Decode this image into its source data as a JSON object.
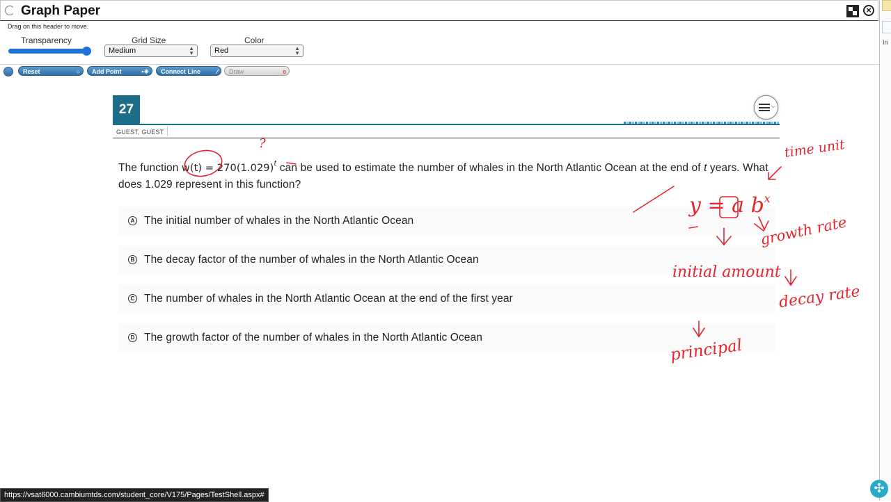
{
  "graph_paper": {
    "title": "Graph Paper",
    "drag_hint": "Drag on this header to move.",
    "transparency_label": "Transparency",
    "transparency_level": 1.0,
    "grid_size_label": "Grid Size",
    "grid_size_value": "Medium",
    "color_label": "Color",
    "color_value": "Red"
  },
  "toolbar": {
    "reset_label": "Reset",
    "add_point_label": "Add Point",
    "connect_line_label": "Connect Line",
    "draw_label": "Draw"
  },
  "question": {
    "number": "27",
    "student": "GUEST, GUEST",
    "stem_before": "The function ",
    "stem_math": "w(t) = 270(1.029)",
    "stem_exp": "t",
    "stem_mid": " can be used to estimate the number of whales in the North Atlantic Ocean at the end of ",
    "stem_var": "t",
    "stem_after": " years. What does 1.029 represent in this function?",
    "choices": [
      {
        "letter": "A",
        "text": "The initial number of whales in the North Atlantic Ocean"
      },
      {
        "letter": "B",
        "text": "The decay factor of the number of whales in the North Atlantic Ocean"
      },
      {
        "letter": "C",
        "text": "The number of whales in the North Atlantic Ocean at the end of the first year"
      },
      {
        "letter": "D",
        "text": "The growth factor of the number of whales in the North Atlantic Ocean"
      }
    ]
  },
  "annotations": {
    "question_mark": "?",
    "time_unit": "time unit",
    "formula": "y = a b",
    "formula_exp": "x",
    "growth_rate": "growth rate",
    "decay_rate": "decay rate",
    "initial_amount": "initial amount",
    "principal": "principal",
    "ink_color": "#e2262d"
  },
  "status_bar": {
    "url": "https://vsat6000.cambiumtds.com/student_core/V175/Pages/TestShell.aspx#"
  },
  "right_edge": {
    "label": "In"
  },
  "colors": {
    "accent": "#1c6d87",
    "button": "#2f6fa6",
    "slider": "#1e72d8"
  }
}
